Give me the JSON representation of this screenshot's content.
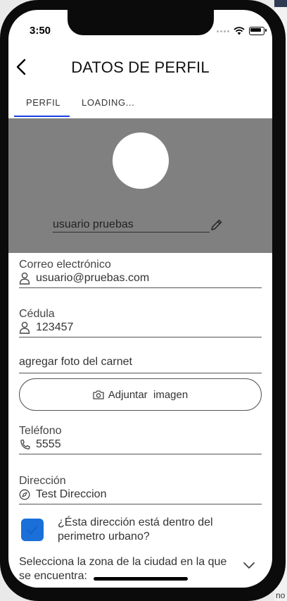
{
  "status": {
    "time": "3:50"
  },
  "header": {
    "title": "DATOS DE PERFIL"
  },
  "tabs": [
    {
      "label": "PERFIL"
    },
    {
      "label": "LOADING..."
    }
  ],
  "profile": {
    "username": "usuario pruebas"
  },
  "fields": {
    "email": {
      "label": "Correo electrónico",
      "value": "usuario@pruebas.com",
      "icon": "user-icon"
    },
    "cedula": {
      "label": "Cédula",
      "value": "123457",
      "icon": "user-icon"
    },
    "phone": {
      "label": "Teléfono",
      "value": "5555",
      "icon": "phone-icon"
    },
    "address": {
      "label": "Dirección",
      "value": "Test Direccion",
      "icon": "compass-icon"
    }
  },
  "carnet": {
    "text": "agregar foto del carnet"
  },
  "attach_button": {
    "label": "Adjuntar  imagen",
    "icon": "camera-icon"
  },
  "urban_check": {
    "text": "¿Ésta dirección está dentro del perimetro urbano?",
    "checked": true,
    "color": "#1a6fd9"
  },
  "zone_select": {
    "text": "Selecciona la zona de la ciudad en la que se encuentra:"
  },
  "background": {
    "edge_text": "no"
  },
  "colors": {
    "hero_bg": "#808080",
    "tab_indicator": "#1b3fe6"
  }
}
